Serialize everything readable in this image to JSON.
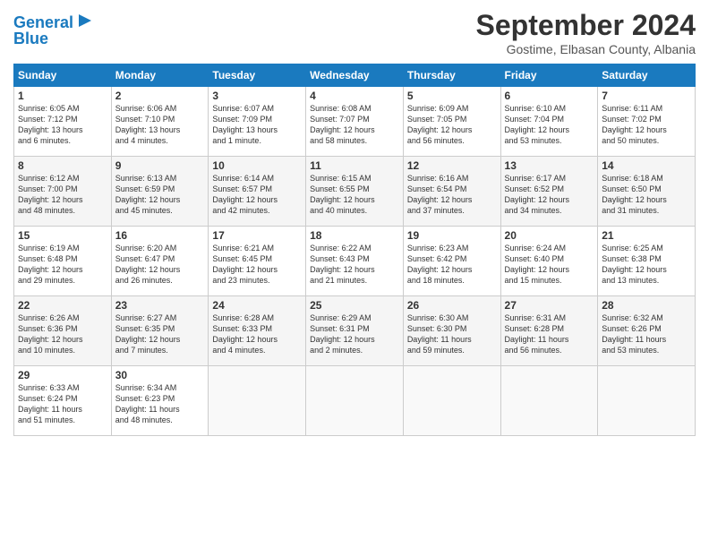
{
  "header": {
    "logo_line1": "General",
    "logo_line2": "Blue",
    "month_title": "September 2024",
    "subtitle": "Gostime, Elbasan County, Albania"
  },
  "weekdays": [
    "Sunday",
    "Monday",
    "Tuesday",
    "Wednesday",
    "Thursday",
    "Friday",
    "Saturday"
  ],
  "weeks": [
    [
      {
        "day": "1",
        "lines": [
          "Sunrise: 6:05 AM",
          "Sunset: 7:12 PM",
          "Daylight: 13 hours",
          "and 6 minutes."
        ]
      },
      {
        "day": "2",
        "lines": [
          "Sunrise: 6:06 AM",
          "Sunset: 7:10 PM",
          "Daylight: 13 hours",
          "and 4 minutes."
        ]
      },
      {
        "day": "3",
        "lines": [
          "Sunrise: 6:07 AM",
          "Sunset: 7:09 PM",
          "Daylight: 13 hours",
          "and 1 minute."
        ]
      },
      {
        "day": "4",
        "lines": [
          "Sunrise: 6:08 AM",
          "Sunset: 7:07 PM",
          "Daylight: 12 hours",
          "and 58 minutes."
        ]
      },
      {
        "day": "5",
        "lines": [
          "Sunrise: 6:09 AM",
          "Sunset: 7:05 PM",
          "Daylight: 12 hours",
          "and 56 minutes."
        ]
      },
      {
        "day": "6",
        "lines": [
          "Sunrise: 6:10 AM",
          "Sunset: 7:04 PM",
          "Daylight: 12 hours",
          "and 53 minutes."
        ]
      },
      {
        "day": "7",
        "lines": [
          "Sunrise: 6:11 AM",
          "Sunset: 7:02 PM",
          "Daylight: 12 hours",
          "and 50 minutes."
        ]
      }
    ],
    [
      {
        "day": "8",
        "lines": [
          "Sunrise: 6:12 AM",
          "Sunset: 7:00 PM",
          "Daylight: 12 hours",
          "and 48 minutes."
        ]
      },
      {
        "day": "9",
        "lines": [
          "Sunrise: 6:13 AM",
          "Sunset: 6:59 PM",
          "Daylight: 12 hours",
          "and 45 minutes."
        ]
      },
      {
        "day": "10",
        "lines": [
          "Sunrise: 6:14 AM",
          "Sunset: 6:57 PM",
          "Daylight: 12 hours",
          "and 42 minutes."
        ]
      },
      {
        "day": "11",
        "lines": [
          "Sunrise: 6:15 AM",
          "Sunset: 6:55 PM",
          "Daylight: 12 hours",
          "and 40 minutes."
        ]
      },
      {
        "day": "12",
        "lines": [
          "Sunrise: 6:16 AM",
          "Sunset: 6:54 PM",
          "Daylight: 12 hours",
          "and 37 minutes."
        ]
      },
      {
        "day": "13",
        "lines": [
          "Sunrise: 6:17 AM",
          "Sunset: 6:52 PM",
          "Daylight: 12 hours",
          "and 34 minutes."
        ]
      },
      {
        "day": "14",
        "lines": [
          "Sunrise: 6:18 AM",
          "Sunset: 6:50 PM",
          "Daylight: 12 hours",
          "and 31 minutes."
        ]
      }
    ],
    [
      {
        "day": "15",
        "lines": [
          "Sunrise: 6:19 AM",
          "Sunset: 6:48 PM",
          "Daylight: 12 hours",
          "and 29 minutes."
        ]
      },
      {
        "day": "16",
        "lines": [
          "Sunrise: 6:20 AM",
          "Sunset: 6:47 PM",
          "Daylight: 12 hours",
          "and 26 minutes."
        ]
      },
      {
        "day": "17",
        "lines": [
          "Sunrise: 6:21 AM",
          "Sunset: 6:45 PM",
          "Daylight: 12 hours",
          "and 23 minutes."
        ]
      },
      {
        "day": "18",
        "lines": [
          "Sunrise: 6:22 AM",
          "Sunset: 6:43 PM",
          "Daylight: 12 hours",
          "and 21 minutes."
        ]
      },
      {
        "day": "19",
        "lines": [
          "Sunrise: 6:23 AM",
          "Sunset: 6:42 PM",
          "Daylight: 12 hours",
          "and 18 minutes."
        ]
      },
      {
        "day": "20",
        "lines": [
          "Sunrise: 6:24 AM",
          "Sunset: 6:40 PM",
          "Daylight: 12 hours",
          "and 15 minutes."
        ]
      },
      {
        "day": "21",
        "lines": [
          "Sunrise: 6:25 AM",
          "Sunset: 6:38 PM",
          "Daylight: 12 hours",
          "and 13 minutes."
        ]
      }
    ],
    [
      {
        "day": "22",
        "lines": [
          "Sunrise: 6:26 AM",
          "Sunset: 6:36 PM",
          "Daylight: 12 hours",
          "and 10 minutes."
        ]
      },
      {
        "day": "23",
        "lines": [
          "Sunrise: 6:27 AM",
          "Sunset: 6:35 PM",
          "Daylight: 12 hours",
          "and 7 minutes."
        ]
      },
      {
        "day": "24",
        "lines": [
          "Sunrise: 6:28 AM",
          "Sunset: 6:33 PM",
          "Daylight: 12 hours",
          "and 4 minutes."
        ]
      },
      {
        "day": "25",
        "lines": [
          "Sunrise: 6:29 AM",
          "Sunset: 6:31 PM",
          "Daylight: 12 hours",
          "and 2 minutes."
        ]
      },
      {
        "day": "26",
        "lines": [
          "Sunrise: 6:30 AM",
          "Sunset: 6:30 PM",
          "Daylight: 11 hours",
          "and 59 minutes."
        ]
      },
      {
        "day": "27",
        "lines": [
          "Sunrise: 6:31 AM",
          "Sunset: 6:28 PM",
          "Daylight: 11 hours",
          "and 56 minutes."
        ]
      },
      {
        "day": "28",
        "lines": [
          "Sunrise: 6:32 AM",
          "Sunset: 6:26 PM",
          "Daylight: 11 hours",
          "and 53 minutes."
        ]
      }
    ],
    [
      {
        "day": "29",
        "lines": [
          "Sunrise: 6:33 AM",
          "Sunset: 6:24 PM",
          "Daylight: 11 hours",
          "and 51 minutes."
        ]
      },
      {
        "day": "30",
        "lines": [
          "Sunrise: 6:34 AM",
          "Sunset: 6:23 PM",
          "Daylight: 11 hours",
          "and 48 minutes."
        ]
      },
      {
        "day": "",
        "lines": []
      },
      {
        "day": "",
        "lines": []
      },
      {
        "day": "",
        "lines": []
      },
      {
        "day": "",
        "lines": []
      },
      {
        "day": "",
        "lines": []
      }
    ]
  ]
}
